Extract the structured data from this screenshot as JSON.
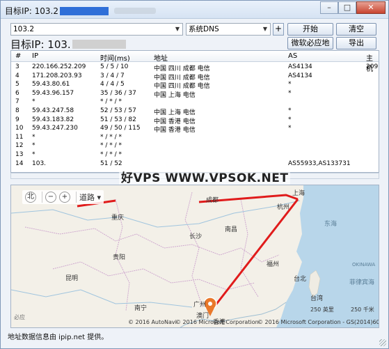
{
  "window": {
    "title": "目标IP: 103.2",
    "minimize_glyph": "–",
    "maximize_glyph": "□",
    "close_glyph": "✕"
  },
  "toolbar": {
    "target_value": "103.2",
    "dns_value": "系统DNS",
    "plus_label": "+",
    "start_label": "开始",
    "clear_label": "清空",
    "microsoft_map_label": "微软必应地图",
    "export_label": "导出"
  },
  "headline": "目标IP:  103.",
  "table": {
    "columns": [
      "#",
      "IP",
      "时间(ms)",
      "地址",
      "AS",
      "主机"
    ],
    "rows": [
      [
        "3",
        "220.166.252.209",
        "5 / 5 / 10",
        "中国 四川 成都 电信",
        "AS4134",
        "209"
      ],
      [
        "4",
        "171.208.203.93",
        "3 / 4 / 7",
        "中国 四川 成都 电信",
        "AS4134",
        ""
      ],
      [
        "5",
        "59.43.80.61",
        "4 / 4 / 5",
        "中国 四川 成都 电信",
        "*",
        ""
      ],
      [
        "6",
        "59.43.96.157",
        "35 / 36 / 37",
        "中国 上海 电信",
        "*",
        ""
      ],
      [
        "7",
        "*",
        "* / * / *",
        "",
        "",
        ""
      ],
      [
        "8",
        "59.43.247.58",
        "52 / 53 / 57",
        "中国 上海 电信",
        "*",
        ""
      ],
      [
        "9",
        "59.43.183.82",
        "51 / 53 / 82",
        "中国 香港 电信",
        "*",
        ""
      ],
      [
        "10",
        "59.43.247.230",
        "49 / 50 / 115",
        "中国 香港 电信",
        "*",
        ""
      ],
      [
        "11",
        "*",
        "* / * / *",
        "",
        "",
        ""
      ],
      [
        "12",
        "*",
        "* / * / *",
        "",
        "",
        ""
      ],
      [
        "13",
        "*",
        "* / * / *",
        "",
        "",
        ""
      ],
      [
        "14",
        "103.",
        "51 / 52",
        "",
        "AS55933,AS133731",
        ""
      ]
    ]
  },
  "watermark": "好VPS WWW.VPSOK.NET",
  "map": {
    "zoom_out_glyph": "−",
    "zoom_in_glyph": "+",
    "compass_label": "北",
    "road_label": "道路",
    "cities": [
      "上海",
      "杭州",
      "成都",
      "重庆",
      "南昌",
      "长沙",
      "贵阳",
      "福州",
      "台北",
      "昆明",
      "南宁",
      "广州",
      "澳门",
      "香港",
      "东海",
      "台湾",
      "OKINAWA",
      "菲律宾海"
    ],
    "copyright_1": "© 2016 AutoNavi",
    "copyright_2": "© 2016 Microsoft Corporation",
    "copyright_3": "© 2016 Microsoft Corporation - GS(2014)6030",
    "scale_1": "250 英里",
    "scale_2": "250 千米",
    "bing_label": "必应",
    "route_color": "#e01b1b",
    "pin_color": "#e9782b"
  },
  "status": "地址数据信息由 ipip.net 提供。"
}
